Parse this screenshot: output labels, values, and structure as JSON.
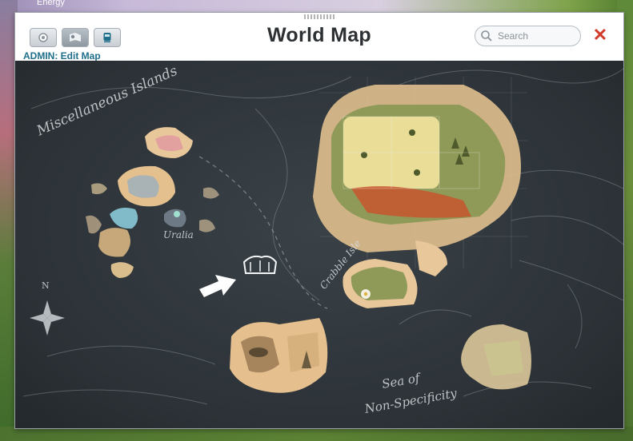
{
  "background": {
    "top_label": "Energy"
  },
  "window": {
    "title": "World Map",
    "admin_label": "ADMIN: Edit Map",
    "toolbar": {
      "buttons": [
        {
          "icon": "gear-icon"
        },
        {
          "icon": "map-pin-icon"
        },
        {
          "icon": "train-icon"
        }
      ]
    },
    "search": {
      "placeholder": "Search"
    },
    "close_label": "✕"
  },
  "map": {
    "labels": {
      "miscellaneous_islands": "Miscellaneous Islands",
      "uralia": "Uralia",
      "crabble_isle": "Crabble Isle",
      "sea_line1": "Sea of",
      "sea_line2": "Non-Specificity",
      "north": "N"
    },
    "colors": {
      "ocean": "#2c3237",
      "sand": "#e8c79a",
      "grass": "#9aa05a",
      "meadow": "#e9dd98",
      "chalk": "#d7dcdf",
      "red_clay": "#c8562e"
    }
  }
}
